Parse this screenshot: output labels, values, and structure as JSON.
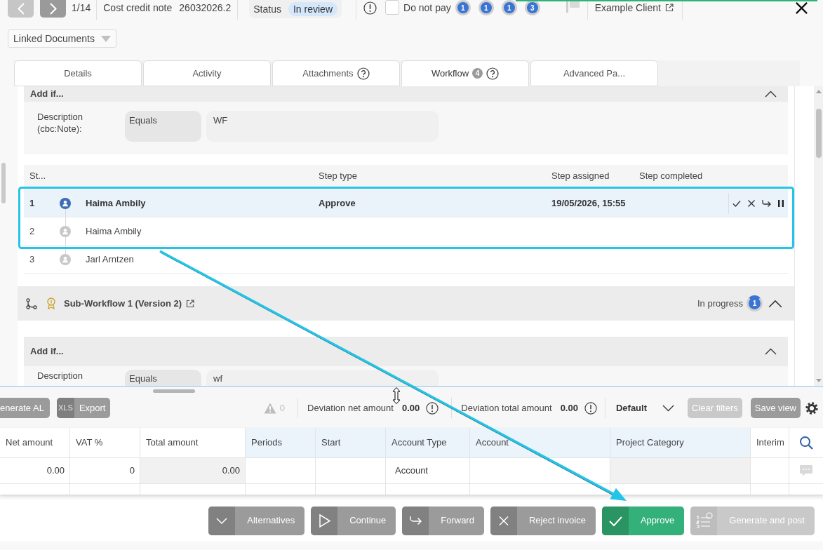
{
  "header": {
    "nav_buttons": [
      {
        "kind": "previous",
        "disabled": true
      },
      {
        "kind": "next",
        "disabled": false
      }
    ],
    "pager": "1/14",
    "document_type": "Cost credit note",
    "document_number": "26032026.2",
    "status": {
      "label": "Status",
      "value": "In review"
    },
    "do_not_pay": {
      "label": "Do not pay",
      "checked": false
    },
    "counters": [
      "1",
      "1",
      "1",
      "3"
    ],
    "client": "Example Client"
  },
  "linked_documents": "Linked Documents",
  "tabs": [
    {
      "label": "Details",
      "selected": false,
      "help": false
    },
    {
      "label": "Activity",
      "selected": false,
      "help": false
    },
    {
      "label": "Attachments",
      "selected": false,
      "help": true
    },
    {
      "label": "Workflow",
      "count": "4",
      "selected": true,
      "help": true
    },
    {
      "label": "Advanced Pa...",
      "selected": false,
      "help": false
    }
  ],
  "workflow": {
    "add_if": {
      "title": "Add if...",
      "expanded": true,
      "conditions": [
        {
          "field": "Description (cbc:Note):",
          "operator": "Equals",
          "value": "WF"
        }
      ]
    },
    "steps": {
      "columns": [
        "St...",
        "Step type",
        "Step assigned",
        "Step completed"
      ],
      "rows": [
        {
          "step": "1",
          "user": "Haima Ambily",
          "step_type": "Approve",
          "assigned": "19/05/2026, 15:55",
          "current": true
        },
        {
          "step": "2",
          "user": "Haima Ambily",
          "current": false
        },
        {
          "step": "3",
          "user": "Jarl Arntzen",
          "current": false
        }
      ]
    },
    "sub_workflow": {
      "title": "Sub-Workflow 1 (Version 2)",
      "status": "In progress",
      "progress": "1",
      "expanded": true,
      "add_if": {
        "title": "Add if...",
        "expanded": true,
        "conditions": [
          {
            "field": "Description",
            "operator": "Equals",
            "value": "wf"
          }
        ]
      }
    }
  },
  "grid_toolbar": {
    "buttons": [
      {
        "label": "enerate AL",
        "kind": "plain"
      },
      {
        "label": "Export",
        "tag": "XLS",
        "kind": "export"
      }
    ],
    "warnings": "0",
    "deviations": [
      {
        "label": "Deviation net amount",
        "value": "0.00"
      },
      {
        "label": "Deviation total amount",
        "value": "0.00"
      }
    ],
    "view": "Default",
    "actions": [
      {
        "label": "Clear filters",
        "disabled": true
      },
      {
        "label": "Save view",
        "disabled": false
      }
    ]
  },
  "grid": {
    "columns": {
      "net_amount": {
        "label": "Net amount",
        "kind": "number",
        "highlighted": false,
        "read_only": false
      },
      "vat_percent": {
        "label": "VAT %",
        "kind": "number",
        "highlighted": false,
        "read_only": false
      },
      "total_amount": {
        "label": "Total amount",
        "kind": "number",
        "highlighted": false,
        "read_only": true
      },
      "periods": {
        "label": "Periods",
        "highlighted": true,
        "read_only": false
      },
      "start": {
        "label": "Start",
        "highlighted": true,
        "read_only": false
      },
      "account_type": {
        "label": "Account Type",
        "kind": "text",
        "highlighted": true,
        "read_only": false
      },
      "account": {
        "label": "Account",
        "highlighted": true,
        "read_only": false
      },
      "project_category": {
        "label": "Project Category",
        "highlighted": true,
        "read_only": true
      },
      "interim": {
        "label": "Interim",
        "highlighted": false,
        "read_only": false
      }
    },
    "rows": [
      {
        "net_amount": "0.00",
        "vat_percent": "0",
        "total_amount": "0.00",
        "account_type": "Account"
      }
    ]
  },
  "actions": [
    {
      "label": "Alternatives",
      "kind": "alternatives",
      "disabled": false
    },
    {
      "label": "Continue",
      "kind": "continue",
      "disabled": false
    },
    {
      "label": "Forward",
      "kind": "forward",
      "disabled": false
    },
    {
      "label": "Reject invoice",
      "kind": "reject",
      "disabled": false
    },
    {
      "label": "Approve",
      "kind": "approve",
      "disabled": false
    },
    {
      "label": "Generate and post",
      "kind": "post",
      "disabled": true
    }
  ],
  "annotations": {
    "highlight_frame": true,
    "arrow": true
  }
}
